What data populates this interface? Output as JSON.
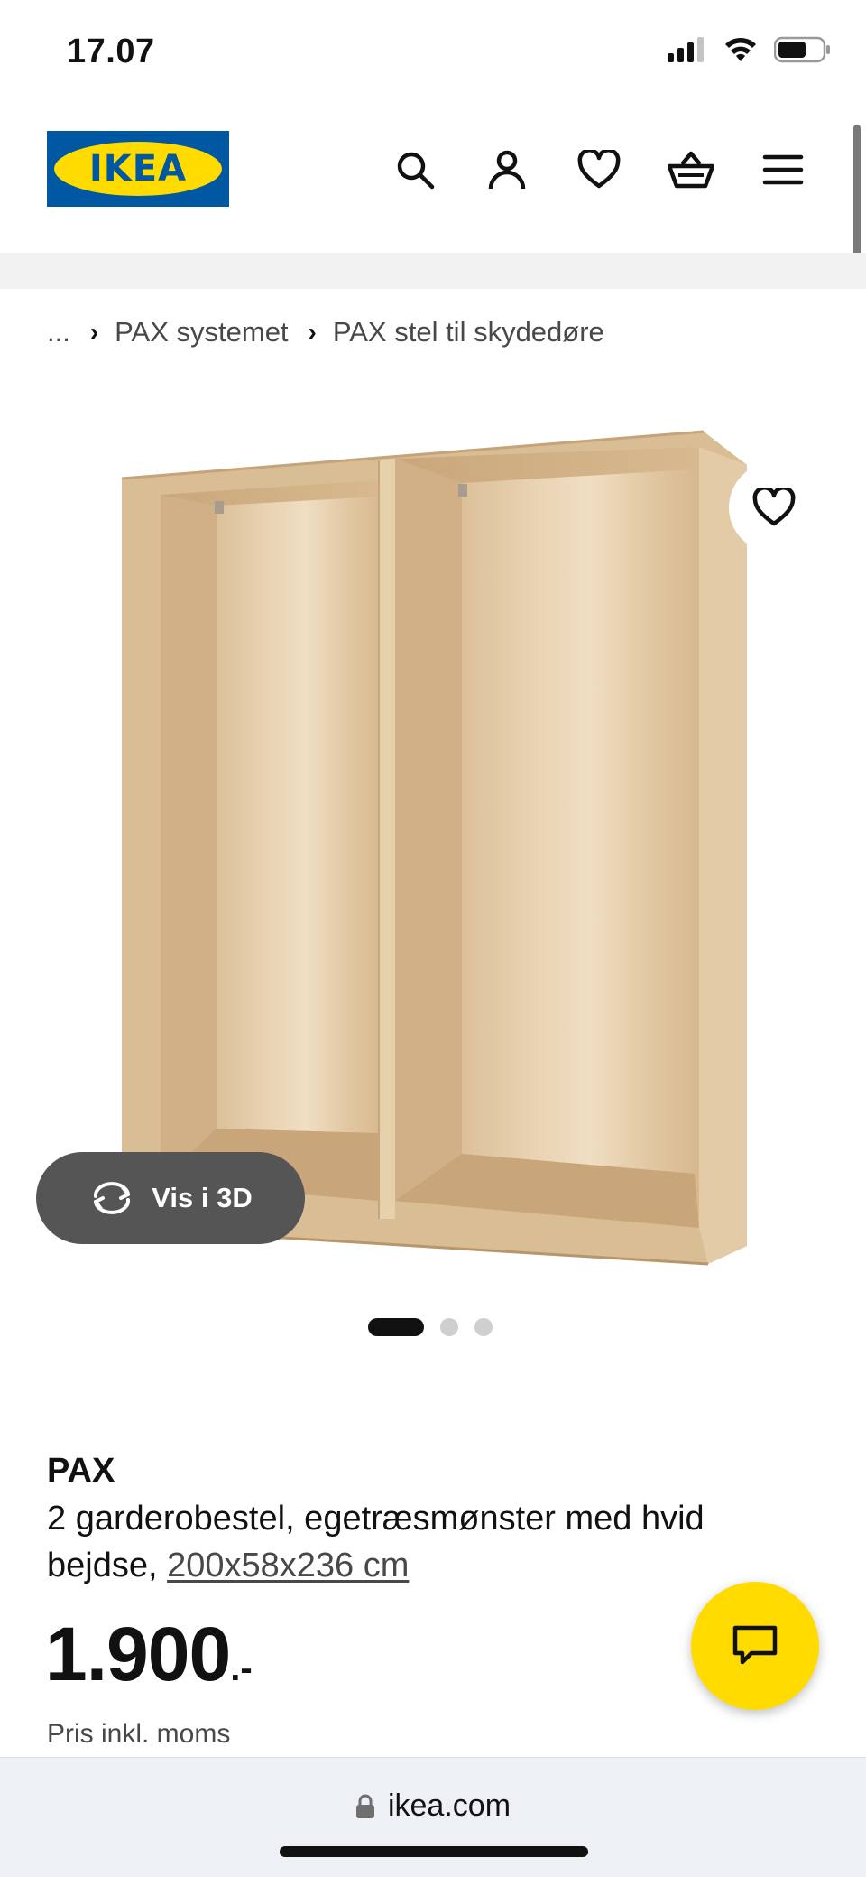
{
  "status": {
    "time": "17.07"
  },
  "header": {
    "logo_text": "IKEA",
    "icons": [
      "search-icon",
      "account-icon",
      "heart-icon",
      "basket-icon",
      "menu-icon"
    ]
  },
  "breadcrumb": {
    "ellipsis": "...",
    "items": [
      "PAX systemet",
      "PAX stel til skydedøre"
    ]
  },
  "gallery": {
    "vis3d_label": "Vis i 3D",
    "active_index": 0,
    "count": 3
  },
  "product": {
    "name": "PAX",
    "description": "2 garderobestel, egetræsmønster med hvid bejdse, ",
    "size": "200x58x236 cm",
    "price": "1.900",
    "price_suffix": ".-",
    "price_note": "Pris inkl. moms"
  },
  "browser": {
    "url": "ikea.com"
  },
  "colors": {
    "brand_blue": "#0058a3",
    "brand_yellow": "#ffdb00"
  }
}
